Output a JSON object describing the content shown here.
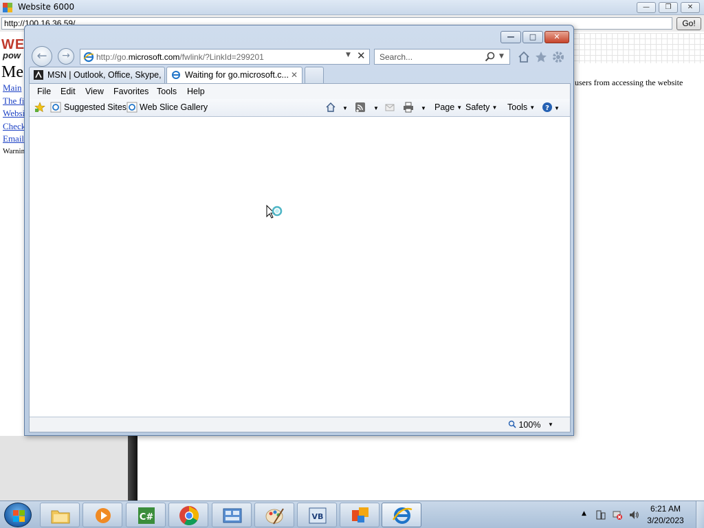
{
  "bg_window": {
    "title": "Website 6000",
    "url_value": "http://100.16.36.59/",
    "go_label": "Go!",
    "logo_line1": "WE",
    "logo_line2": "pow",
    "heading": "Me",
    "links": [
      "Main",
      "The fi",
      "Websi",
      "Check",
      "Email"
    ],
    "warning_text": "Warnin",
    "right_text": "users from accessing the website"
  },
  "ie": {
    "address": {
      "prefix": "http://go.",
      "domain": "microsoft.com",
      "suffix": "/fwlink/?LinkId=299201"
    },
    "search_placeholder": "Search...",
    "tabs": [
      {
        "label": "MSN | Outlook, Office, Skype, ...",
        "icon": "msn-icon"
      },
      {
        "label": "Waiting for go.microsoft.c...",
        "icon": "ie-page-icon"
      }
    ],
    "menu": [
      "File",
      "Edit",
      "View",
      "Favorites",
      "Tools",
      "Help"
    ],
    "favorites": [
      "Suggested Sites",
      "Web Slice Gallery"
    ],
    "commands": [
      "Page",
      "Safety",
      "Tools"
    ],
    "zoom": "100%"
  },
  "taskbar": {
    "apps": [
      "file-explorer-icon",
      "media-player-icon",
      "visual-csharp-icon",
      "chrome-icon",
      "control-panel-icon",
      "paint-icon",
      "visual-basic-icon",
      "office-icon",
      "internet-explorer-icon"
    ],
    "active_app": "internet-explorer-icon",
    "time": "6:21 AM",
    "date": "3/20/2023"
  },
  "colors": {
    "link": "#1a3fc4",
    "logo_red": "#c0392b",
    "ie_blue": "#1f74c8"
  }
}
